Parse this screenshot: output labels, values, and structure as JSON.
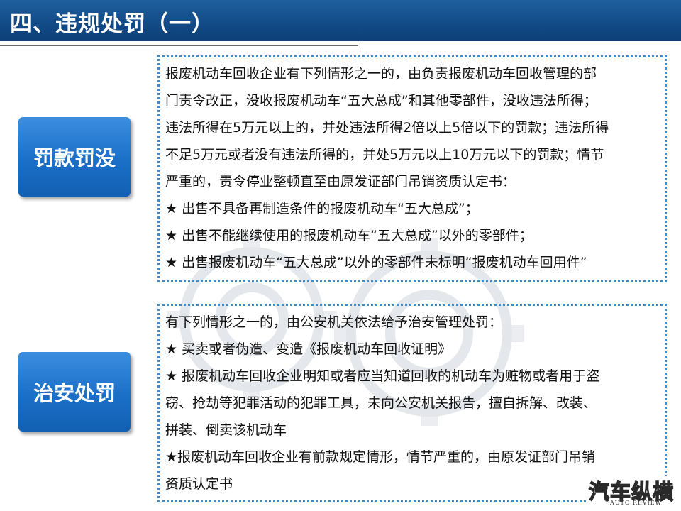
{
  "title": "四、违规处罚（一）",
  "sections": [
    {
      "label": "罚款罚没",
      "lines": [
        "报废机动车回收企业有下列情形之一的，由负责报废机动车回收管理的部",
        "门责令改正，没收报废机动车“五大总成”和其他零部件，没收违法所得；",
        "违法所得在5万元以上的，并处违法所得2倍以上5倍以下的罚款；违法所得",
        "不足5万元或者没有违法所得的，并处5万元以上10万元以下的罚款；情节",
        "严重的，责令停业整顿直至由原发证部门吊销资质认定书：",
        "★ 出售不具备再制造条件的报废机动车“五大总成”；",
        "★ 出售不能继续使用的报废机动车“五大总成”以外的零部件；",
        "★ 出售报废机动车“五大总成”以外的零部件未标明“报废机动车回用件”"
      ]
    },
    {
      "label": "治安处罚",
      "lines": [
        "有下列情形之一的，由公安机关依法给予治安管理处罚：",
        "★ 买卖或者伪造、变造《报废机动车回收证明》",
        "★ 报废机动车回收企业明知或者应当知道回收的机动车为赃物或者用于盗",
        "窃、抢劫等犯罪活动的犯罪工具，未向公安机关报告，擅自拆解、改装、",
        "拼装、倒卖该机动车",
        "★报废机动车回收企业有前款规定情形，情节严重的，由原发证部门吊销",
        "资质认定书"
      ]
    }
  ],
  "logo": {
    "cn": "汽车纵横",
    "en": "AUTO REVIEW"
  }
}
